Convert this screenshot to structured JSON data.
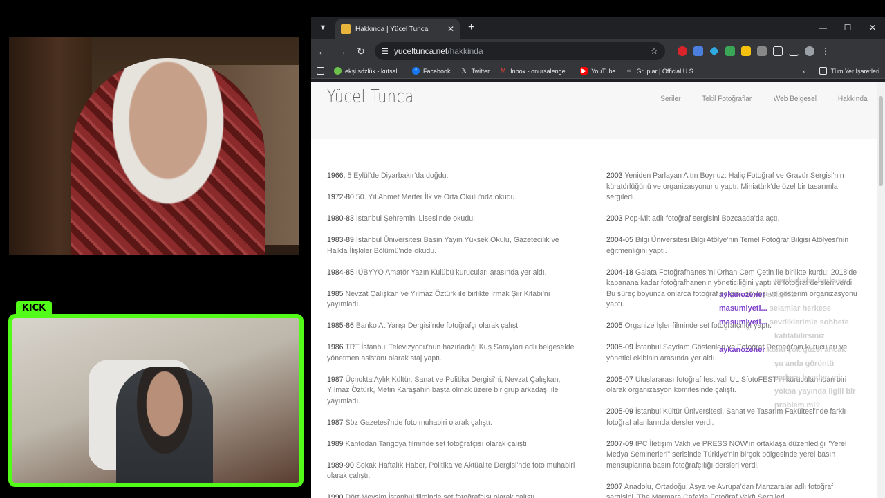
{
  "overlay": {
    "kick_label": "KICK"
  },
  "browser": {
    "tab": {
      "title": "Hakkında | Yücel Tunca"
    },
    "url": {
      "domain": "yuceltunca.net",
      "path": "/hakkinda"
    },
    "bookmarks": [
      {
        "label": "ekşi sözlük - kutsal...",
        "icon": "leaf-icon",
        "color": "#6cc24a"
      },
      {
        "label": "Facebook",
        "icon": "facebook-icon",
        "color": "#1877f2"
      },
      {
        "label": "Twitter",
        "icon": "x-icon",
        "color": "#ffffff"
      },
      {
        "label": "Inbox - onursalenge...",
        "icon": "gmail-icon",
        "color": "#ea4335"
      },
      {
        "label": "YouTube",
        "icon": "youtube-icon",
        "color": "#ff0000"
      },
      {
        "label": "Gruplar | Official U.S...",
        "icon": "link-icon",
        "color": "#9aa0a6"
      }
    ],
    "bookmarks_all": "Tüm Yer İşaretleri"
  },
  "site": {
    "title": "Yücel Tunca",
    "nav": [
      "Seriler",
      "Tekil Fotoğraflar",
      "Web Belgesel",
      "Hakkında"
    ],
    "left": [
      {
        "year": "1966",
        "text": ", 5 Eylül'de Diyarbakır'da doğdu."
      },
      {
        "year": "1972-80",
        "text": " 50. Yıl Ahmet Merter İlk ve Orta Okulu'nda okudu."
      },
      {
        "year": "1980-83",
        "text": " İstanbul Şehremini Lisesi'nde okudu."
      },
      {
        "year": "1983-89",
        "text": " İstanbul Üniversitesi Basın Yayın Yüksek Okulu, Gazetecilik ve Halkla İlişkiler Bölümü'nde okudu."
      },
      {
        "year": "1984-85",
        "text": " IÜBYYO Amatör Yazın Kulübü kurucuları arasında yer aldı."
      },
      {
        "year": "1985",
        "text": " Nevzat Çalışkan ve Yılmaz Öztürk ile birlikte Irmak Şiir Kitabı'nı yayımladı."
      },
      {
        "year": "1985-86",
        "text": " Banko At Yarışı Dergisi'nde fotoğrafçı olarak çalıştı."
      },
      {
        "year": "1986",
        "text": " TRT İstanbul Televizyonu'nun hazırladığı Kuş Sarayları adlı belgeselde yönetmen asistanı olarak staj yaptı."
      },
      {
        "year": "1987",
        "text": " Üçnokta Aylık Kültür, Sanat ve Politika Dergisi'ni, Nevzat Çalışkan, Yılmaz Öztürk, Metin Karaşahin başta olmak üzere bir grup arkadaşı ile yayımladı."
      },
      {
        "year": "1987",
        "text": " Söz Gazetesi'nde foto muhabiri olarak çalıştı."
      },
      {
        "year": "1989",
        "text": " Kantodan Tangoya filminde set fotoğrafçısı olarak çalıştı."
      },
      {
        "year": "1989-90",
        "text": " Sokak Haftalık Haber, Politika ve Aktüalite Dergisi'nde foto muhabiri olarak çalıştı."
      },
      {
        "year": "1990",
        "text": " Dört Mevsim İstanbul filminde set fotoğrafçısı olarak çalıştı."
      }
    ],
    "right": [
      {
        "year": "2003",
        "text": " Yeniden Parlayan Altın Boynuz: Haliç Fotoğraf ve Gravür Sergisi'nin küratörlüğünü ve organizasyonunu yaptı. Miniatürk'de özel bir tasarımla sergiledi."
      },
      {
        "year": "2003",
        "text": " Pop-Mit adlı fotoğraf sergisini Bozcaada'da açtı."
      },
      {
        "year": "2004-05",
        "text": " Bilgi Üniversitesi Bilgi Atölye'nin Temel Fotoğraf Bilgisi Atölyesi'nin eğitmenliğini yaptı."
      },
      {
        "year": "2004-18",
        "text": " Galata Fotoğrafhanesi'ni Orhan Cem Çetin ile birlikte kurdu; 2018'de kapanana kadar fotoğrafhanenin yöneticiliğini yaptı ve fotoğraf dersleri verdi. Bu süreç boyunca onlarca fotoğraf sergisi, söyleşi ve gösterim organizasyonu yaptı."
      },
      {
        "year": "2005",
        "text": " Organize İşler filminde set fotoğrafçılığı yaptı."
      },
      {
        "year": "2005-09",
        "text": " İstanbul Saydam Gösterileri ve Fotoğraf Derneği'nin kurucuları ve yönetici ekibinin arasında yer aldı."
      },
      {
        "year": "2005-07",
        "text": " Uluslararası fotoğraf festivali ULISfotoFEST'in kurucularından biri olarak organizasyon komitesinde çalıştı."
      },
      {
        "year": "2005-09",
        "text": " İstanbul Kültür Üniversitesi, Sanat ve Tasarım Fakültesi'nde farklı fotoğraf alanlarında dersler verdi."
      },
      {
        "year": "2007-09",
        "text": " IPC İletişim Vakfı ve PRESS NOW'ın ortaklaşa düzenlediği \"Yerel Medya Seminerleri\" serisinde Türkiye'nin birçok bölgesinde yerel basın mensuplarına basın fotoğrafçılığı dersleri verdi."
      },
      {
        "year": "2007",
        "text": " Anadolu, Ortadoğu, Asya ve Avrupa'dan Manzaralar adlı fotoğraf sergisini, The Marmara Cafe'de Fotoğraf Vakfı Sergileri..."
      }
    ]
  },
  "chat": [
    {
      "nick": "",
      "msg": "merhabalar herkese"
    },
    {
      "nick": "aykanozener",
      "msg": "selamlar"
    },
    {
      "nick": "masumiyeti...",
      "msg": "selamlar herkese"
    },
    {
      "nick": "masumiyeti...",
      "msg": "sevdiklerimle sohbete"
    },
    {
      "nick": "",
      "msg": "katılabilirsiniz"
    },
    {
      "nick": "aykanozener",
      "msg": "konu çok güzel ancak"
    },
    {
      "nick": "",
      "msg": "şu anda görüntü"
    },
    {
      "nick": "",
      "msg": "sadece benden mi"
    },
    {
      "nick": "",
      "msg": "yoksa yayında ilgili bir"
    },
    {
      "nick": "",
      "msg": "problem mi?"
    }
  ]
}
